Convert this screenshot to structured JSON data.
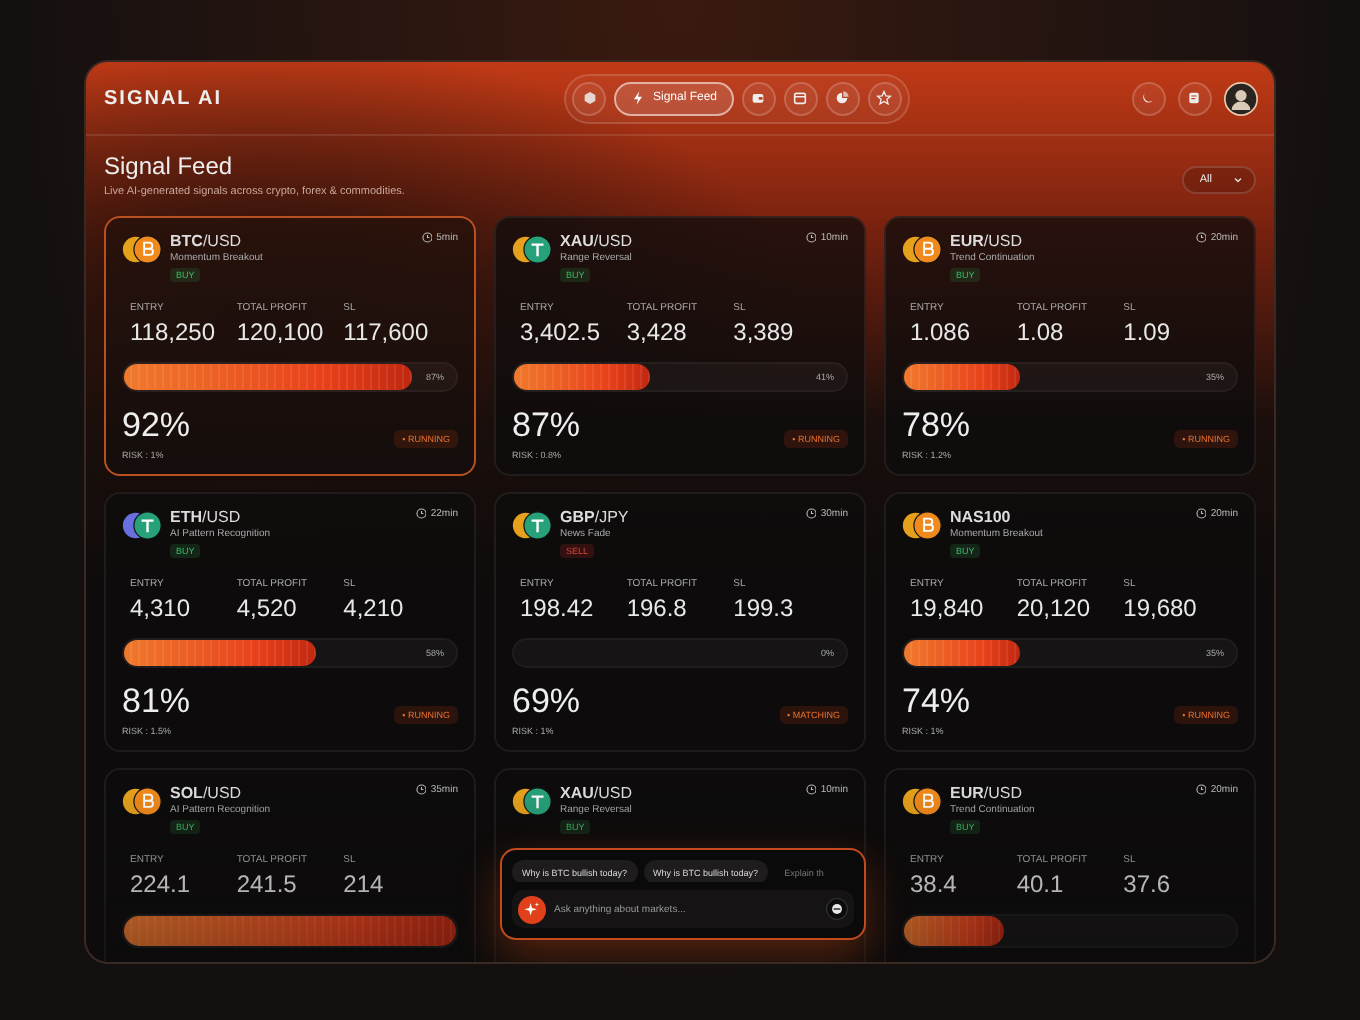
{
  "app": {
    "logo": "SIGNAL AI"
  },
  "nav": [
    {
      "selected": false
    },
    {
      "label": "Signal Feed",
      "selected": true
    },
    {
      "selected": false
    },
    {
      "selected": false
    },
    {
      "selected": false
    },
    {
      "selected": false
    }
  ],
  "page": {
    "title": "Signal Feed",
    "subtitle": "Live AI-generated signals across crypto, forex & commodities.",
    "filter": "All"
  },
  "cards": [
    {
      "pair": "**BTC**/USD",
      "strategy": "Momentum Breakout",
      "side": {
        "label": "BUY",
        "kind": "buy"
      },
      "time": "5min",
      "kind": "btc",
      "color": "#e6a11c",
      "selected": true,
      "metrics": [
        {
          "label": "ENTRY",
          "value": "118,250"
        },
        {
          "label": "TOTAL PROFIT",
          "value": "120,100"
        },
        {
          "label": "SL",
          "value": "117,600"
        }
      ],
      "level": 0.87,
      "bar_label": "87%",
      "confidence": "92%",
      "risk": "RISK : 1%",
      "status": "• RUNNING"
    },
    {
      "pair": "**XAU**/USD",
      "strategy": "Range Reversal",
      "side": {
        "label": "BUY",
        "kind": "buy"
      },
      "time": "10min",
      "kind": "tether",
      "color": "#e6a11c",
      "selected": false,
      "metrics": [
        {
          "label": "ENTRY",
          "value": "3,402.5"
        },
        {
          "label": "TOTAL PROFIT",
          "value": "3,428"
        },
        {
          "label": "SL",
          "value": "3,389"
        }
      ],
      "level": 0.41,
      "bar_label": "41%",
      "confidence": "87%",
      "risk": "RISK : 0.8%",
      "status": "• RUNNING"
    },
    {
      "pair": "**EUR**/USD",
      "strategy": "Trend Continuation",
      "side": {
        "label": "BUY",
        "kind": "buy"
      },
      "time": "20min",
      "kind": "btc",
      "color": "#e6a11c",
      "selected": false,
      "metrics": [
        {
          "label": "ENTRY",
          "value": "1.086"
        },
        {
          "label": "TOTAL PROFIT",
          "value": "1.08"
        },
        {
          "label": "SL",
          "value": "1.09"
        }
      ],
      "level": 0.35,
      "bar_label": "35%",
      "confidence": "78%",
      "risk": "RISK : 1.2%",
      "status": "• RUNNING"
    },
    {
      "pair": "**ETH**/USD",
      "strategy": "AI Pattern Recognition",
      "side": {
        "label": "BUY",
        "kind": "buy"
      },
      "time": "22min",
      "kind": "tether",
      "color": "#6a6fe0",
      "selected": false,
      "metrics": [
        {
          "label": "ENTRY",
          "value": "4,310"
        },
        {
          "label": "TOTAL PROFIT",
          "value": "4,520"
        },
        {
          "label": "SL",
          "value": "4,210"
        }
      ],
      "level": 0.58,
      "bar_label": "58%",
      "confidence": "81%",
      "risk": "RISK : 1.5%",
      "status": "• RUNNING"
    },
    {
      "pair": "**GBP**/JPY",
      "strategy": "News Fade",
      "side": {
        "label": "SELL",
        "kind": "sell"
      },
      "time": "30min",
      "kind": "tether",
      "color": "#e6a11c",
      "selected": false,
      "metrics": [
        {
          "label": "ENTRY",
          "value": "198.42"
        },
        {
          "label": "TOTAL PROFIT",
          "value": "196.8"
        },
        {
          "label": "SL",
          "value": "199.3"
        }
      ],
      "bar_label": "0%",
      "confidence": "69%",
      "risk": "RISK : 1%",
      "status": "• MATCHING"
    },
    {
      "pair": "**NAS100**",
      "strategy": "Momentum Breakout",
      "side": {
        "label": "BUY",
        "kind": "buy"
      },
      "time": "20min",
      "kind": "btc",
      "color": "#e6a11c",
      "selected": false,
      "metrics": [
        {
          "label": "ENTRY",
          "value": "19,840"
        },
        {
          "label": "TOTAL PROFIT",
          "value": "20,120"
        },
        {
          "label": "SL",
          "value": "19,680"
        }
      ],
      "level": 0.35,
      "bar_label": "35%",
      "confidence": "74%",
      "risk": "RISK : 1%",
      "status": "• RUNNING"
    },
    {
      "pair": "**SOL**/USD",
      "strategy": "AI Pattern Recognition",
      "side": {
        "label": "BUY",
        "kind": "buy"
      },
      "time": "35min",
      "kind": "btc",
      "color": "#e6a11c",
      "selected": false,
      "metrics": [
        {
          "label": "ENTRY",
          "value": "224.1"
        },
        {
          "label": "TOTAL PROFIT",
          "value": "241.5"
        },
        {
          "label": "SL",
          "value": "214"
        }
      ],
      "level": 1
    },
    {
      "pair": "**XAU**/USD",
      "strategy": "Range Reversal",
      "side": {
        "label": "BUY",
        "kind": "buy"
      },
      "time": "10min",
      "kind": "tether",
      "color": "#e6a11c",
      "selected": false
    },
    {
      "pair": "**EUR**/USD",
      "strategy": "Trend Continuation",
      "side": {
        "label": "BUY",
        "kind": "buy"
      },
      "time": "20min",
      "kind": "btc",
      "color": "#e6a11c",
      "selected": false,
      "metrics": [
        {
          "label": "ENTRY",
          "value": "38.4"
        },
        {
          "label": "TOTAL PROFIT",
          "value": "40.1"
        },
        {
          "label": "SL",
          "value": "37.6"
        }
      ],
      "level": 0.3
    }
  ],
  "assistant": {
    "suggestions": [
      "Why is BTC bullish today?",
      "Why is BTC bullish today?",
      "Explain th"
    ],
    "placeholder": "Ask anything about markets..."
  }
}
